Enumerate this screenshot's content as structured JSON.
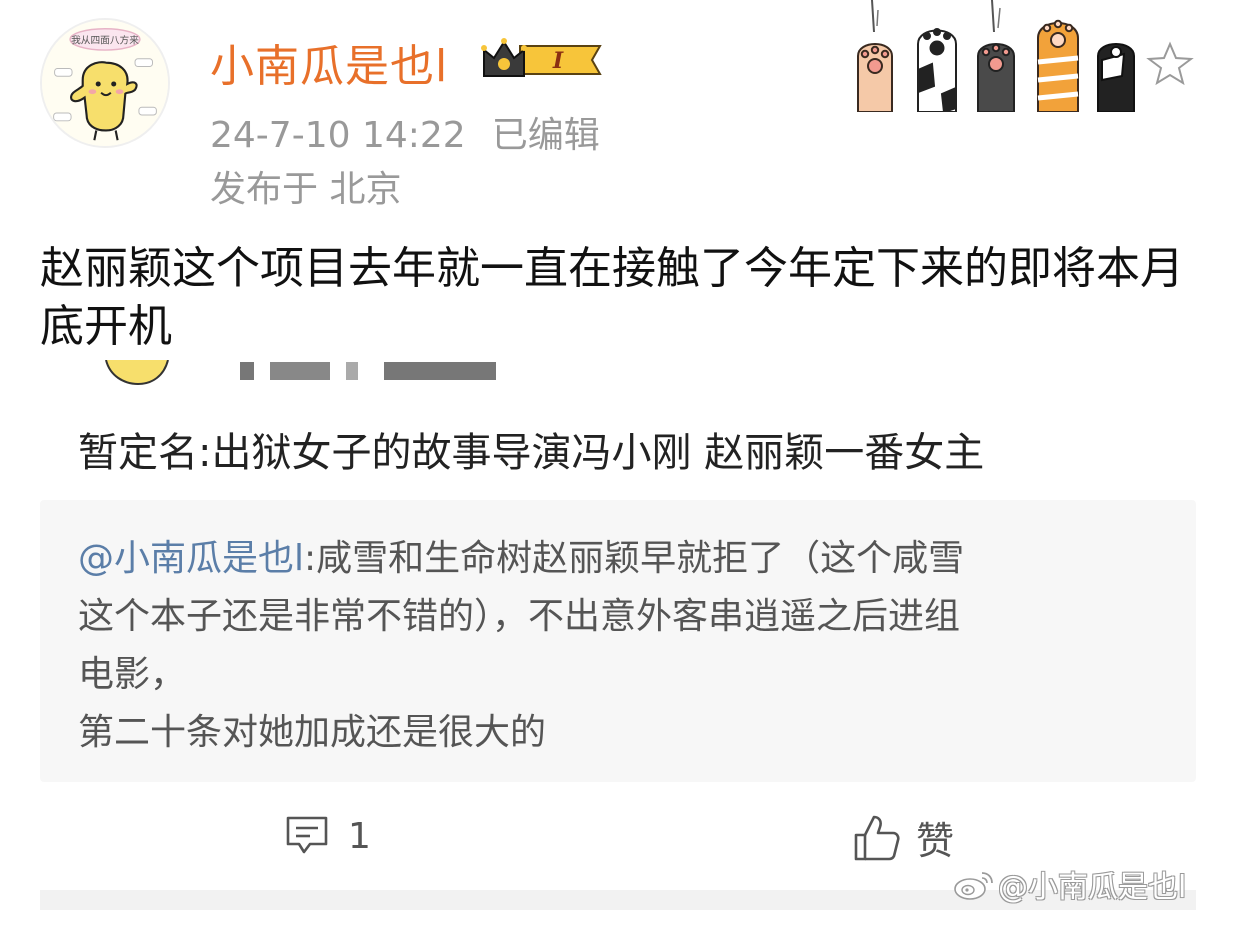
{
  "post": {
    "username": "小南瓜是也l",
    "badge_level": "I",
    "timestamp": "24-7-10 14:22",
    "edited": "已编辑",
    "location": "发布于 北京",
    "text": "赵丽颖这个项目去年就一直在接触了今年定下来的即将本月底开机",
    "avatar_caption": "我从四面八方来"
  },
  "repost": {
    "text": "暂定名:出狱女子的故事导演冯小刚 赵丽颖一番女主"
  },
  "quote": {
    "mention": "@小南瓜是也l",
    "lines": [
      ":咸雪和生命树赵丽颖早就拒了（这个咸雪",
      "这个本子还是非常不错的），不出意外客串逍遥之后进组",
      "电影，",
      "第二十条对她加成还是很大的"
    ]
  },
  "actions": {
    "comment_count": "1",
    "like_label": "赞"
  },
  "watermark": {
    "text": "@小南瓜是也l"
  },
  "colors": {
    "username": "#e8702a",
    "mention": "#5b7ea8",
    "meta": "#999999",
    "quote_bg": "#f7f7f7"
  }
}
